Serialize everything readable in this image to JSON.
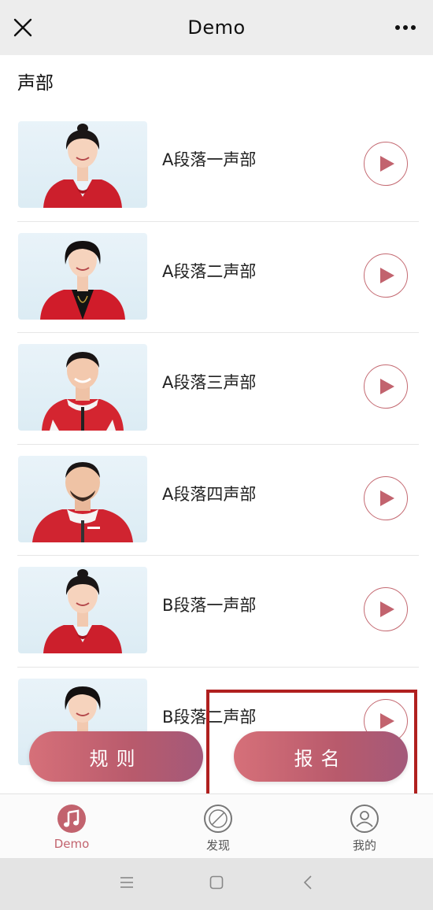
{
  "header": {
    "title": "Demo",
    "close_icon": "close-icon",
    "more_icon": "more-dots-icon"
  },
  "section": {
    "title": "声部"
  },
  "items": [
    {
      "label": "A段落一声部",
      "person": "woman-red-top"
    },
    {
      "label": "A段落二声部",
      "person": "woman-red-blazer"
    },
    {
      "label": "A段落三声部",
      "person": "man-red-jacket"
    },
    {
      "label": "A段落四声部",
      "person": "man-red-jacket-beard"
    },
    {
      "label": "B段落一声部",
      "person": "woman-red-top"
    },
    {
      "label": "B段落二声部",
      "person": "woman-red-blazer"
    }
  ],
  "buttons": {
    "rules": "规则",
    "signup": "报名"
  },
  "tabbar": {
    "tabs": [
      {
        "label": "Demo",
        "icon": "music-note-icon",
        "active": true
      },
      {
        "label": "发现",
        "icon": "compass-icon",
        "active": false
      },
      {
        "label": "我的",
        "icon": "profile-icon",
        "active": false
      }
    ]
  },
  "system_nav": {
    "icons": [
      "menu-icon",
      "home-square-icon",
      "back-chevron-icon"
    ]
  },
  "colors": {
    "accent": "#c2636e",
    "highlight_box": "#b0201f",
    "topbar_bg": "#ededed"
  }
}
